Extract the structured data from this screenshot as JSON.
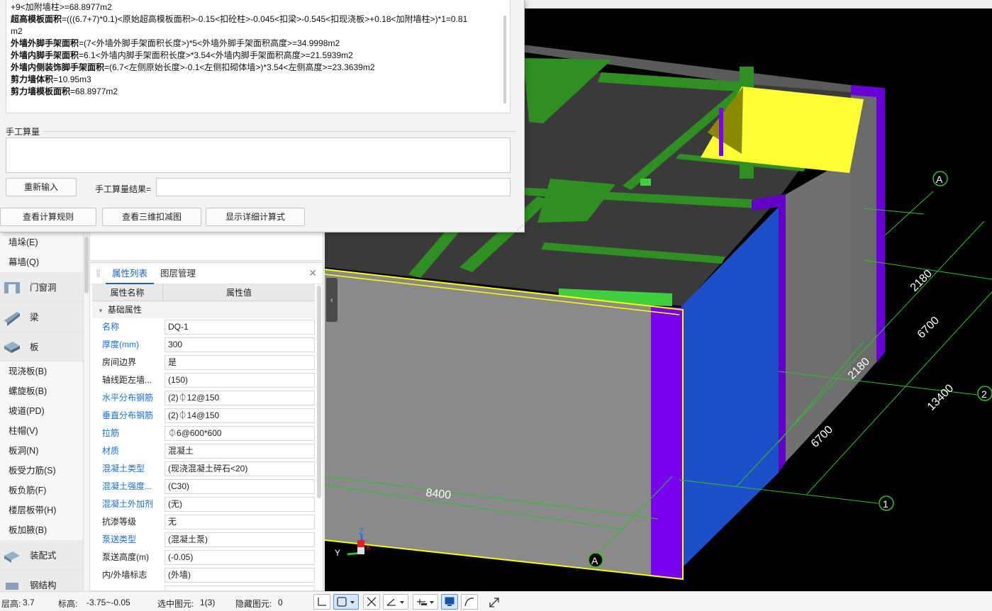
{
  "formula": {
    "lines": [
      {
        "name": "",
        "expr": "+9<加附墙柱>=68.8977m2"
      },
      {
        "name": "超高模板面积",
        "expr": "=(((6.7+7)*0.1)<原始超高模板面积>-0.15<扣砼柱>-0.045<扣梁>-0.545<扣现浇板>+0.18<加附墙柱>)*1=0.81"
      },
      {
        "name": "",
        "expr": "m2"
      },
      {
        "name": "外墙外脚手架面积",
        "expr": "=(7<外墙外脚手架面积长度>)*5<外墙外脚手架面积高度>=34.9998m2"
      },
      {
        "name": "外墙内脚手架面积",
        "expr": "=6.1<外墙内脚手架面积长度>*3.54<外墙内脚手架面积高度>=21.5939m2"
      },
      {
        "name": "外墙内侧装饰脚手架面积",
        "expr": "=(6.7<左侧原始长度>-0.1<左侧扣砌体墙>)*3.54<左侧高度>=23.3639m2"
      },
      {
        "name": "剪力墙体积",
        "expr": "=10.95m3"
      },
      {
        "name": "剪力墙模板面积",
        "expr": "=68.8977m2"
      }
    ]
  },
  "manual": {
    "label": "手工算量",
    "reinput_button": "重新输入",
    "result_label": "手工算量结果="
  },
  "dialog_buttons": {
    "rules": "查看计算规则",
    "view3d": "查看三维扣减图",
    "detail": "显示详细计算式"
  },
  "nav": {
    "items_top": [
      "墙垛(E)",
      "幕墙(Q)"
    ],
    "cat_door": "门窗洞",
    "cat_beam": "梁",
    "cat_slab": "板",
    "items_slab": [
      "现浇板(B)",
      "螺旋板(B)",
      "坡道(PD)",
      "柱帽(V)",
      "板洞(N)",
      "板受力筋(S)",
      "板负筋(F)",
      "楼层板带(H)",
      "板加腋(B)"
    ],
    "cat_prefab": "装配式",
    "cat_steel": "钢结构"
  },
  "props": {
    "tab_active": "属性列表",
    "tab_other": "图层管理",
    "col_name": "属性名称",
    "col_value": "属性值",
    "group": "基础属性",
    "rows": [
      {
        "name": "名称",
        "value": "DQ-1",
        "blue": true
      },
      {
        "name": "厚度(mm)",
        "value": "300",
        "blue": true
      },
      {
        "name": "房间边界",
        "value": "是",
        "blue": false
      },
      {
        "name": "轴线距左墙...",
        "value": "(150)",
        "blue": false
      },
      {
        "name": "水平分布钢筋",
        "value": "(2)⏀12@150",
        "blue": true
      },
      {
        "name": "垂直分布钢筋",
        "value": "(2)⏀14@150",
        "blue": true
      },
      {
        "name": "拉筋",
        "value": "⏀6@600*600",
        "blue": true
      },
      {
        "name": "材质",
        "value": "混凝土",
        "blue": true
      },
      {
        "name": "混凝土类型",
        "value": "(现浇混凝土碎石<20)",
        "blue": true
      },
      {
        "name": "混凝土强度...",
        "value": "(C30)",
        "blue": true
      },
      {
        "name": "混凝土外加剂",
        "value": "(无)",
        "blue": true
      },
      {
        "name": "抗渗等级",
        "value": "无",
        "blue": false
      },
      {
        "name": "泵送类型",
        "value": "(混凝土泵)",
        "blue": true
      },
      {
        "name": "泵送高度(m)",
        "value": "(-0.05)",
        "blue": false
      },
      {
        "name": "内/外墙标志",
        "value": "(外墙)",
        "blue": false
      },
      {
        "name": "",
        "value": "",
        "blue": false
      }
    ]
  },
  "model": {
    "dims": {
      "d8400": "8400",
      "d2180a": "2180",
      "d6700a": "6700",
      "d2180b": "2180",
      "d13400": "13400",
      "d6700b": "6700"
    },
    "axes": {
      "a1": "A",
      "a2": "A",
      "n1": "1",
      "n2": "2"
    },
    "gizmo": {
      "z": "Z",
      "y": "Y",
      "x": "X"
    }
  },
  "status": {
    "floor_height_label": "层高:",
    "floor_height": "3.7",
    "elevation_label": "标高:",
    "elevation": "-3.75~-0.05",
    "selected_label": "选中图元:",
    "selected": "1(3)",
    "hidden_label": "隐藏图元:",
    "hidden": "0"
  },
  "colors": {
    "wall_gray": "#808080",
    "purple": "#7a00f0",
    "blue": "#1c4fc8",
    "green": "#2a8a1e",
    "yellow": "#ffff33",
    "dim_line": "#2fbf2f",
    "select": "#ffff00"
  }
}
